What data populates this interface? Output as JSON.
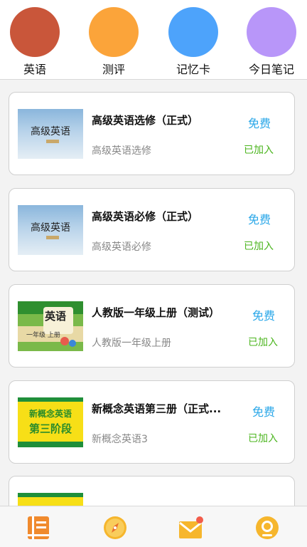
{
  "categories": [
    {
      "label": "英语",
      "color": "#c9563a"
    },
    {
      "label": "测评",
      "color": "#fba43a"
    },
    {
      "label": "记忆卡",
      "color": "#4da3fb"
    },
    {
      "label": "今日笔记",
      "color": "#b896f9"
    }
  ],
  "courses": [
    {
      "title": "高级英语选修（正式）",
      "subtitle": "高级英语选修",
      "price": "免费",
      "status": "已加入",
      "cover_title": "高级英语"
    },
    {
      "title": "高级英语必修（正式）",
      "subtitle": "高级英语必修",
      "price": "免费",
      "status": "已加入",
      "cover_title": "高级英语"
    },
    {
      "title": "人教版一年级上册（测试）",
      "subtitle": "人教版一年级上册",
      "price": "免费",
      "status": "已加入",
      "cover_title": "英语",
      "cover_grade": "一年级 上册"
    },
    {
      "title": "新概念英语第三册（正式...",
      "subtitle": "新概念英语3",
      "price": "免费",
      "status": "已加入",
      "cover_line1": "新概念英语",
      "cover_line2": "第三阶段"
    }
  ],
  "bottom_nav": [
    {
      "icon": "book-icon",
      "color": "#f08a2d"
    },
    {
      "icon": "compass-icon",
      "color": "#f6b62d"
    },
    {
      "icon": "mail-icon",
      "color": "#f6b62d"
    },
    {
      "icon": "profile-icon",
      "color": "#f6b62d"
    }
  ]
}
